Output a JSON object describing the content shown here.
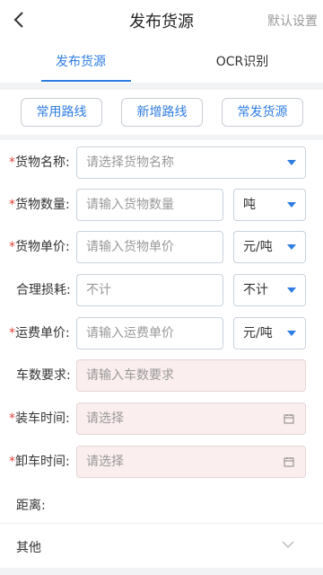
{
  "header": {
    "title": "发布货源",
    "right_action": "默认设置"
  },
  "tabs": [
    {
      "label": "发布货源",
      "active": true
    },
    {
      "label": "OCR识别",
      "active": false
    }
  ],
  "quick_buttons": [
    {
      "label": "常用路线"
    },
    {
      "label": "新增路线"
    },
    {
      "label": "常发货源"
    }
  ],
  "form": {
    "cargo_name": {
      "label": "货物名称:",
      "required": true,
      "placeholder": "请选择货物名称"
    },
    "cargo_quantity": {
      "label": "货物数量:",
      "required": true,
      "placeholder": "请输入货物数量",
      "unit": "吨"
    },
    "cargo_unit_price": {
      "label": "货物单价:",
      "required": true,
      "placeholder": "请输入货物单价",
      "unit": "元/吨"
    },
    "reasonable_loss": {
      "label": "合理损耗:",
      "required": false,
      "placeholder": "不计",
      "option": "不计"
    },
    "freight_unit_price": {
      "label": "运费单价:",
      "required": true,
      "placeholder": "请输入运费单价",
      "unit": "元/吨"
    },
    "vehicle_requirement": {
      "label": "车数要求:",
      "required": false,
      "placeholder": "请输入车数要求"
    },
    "loading_time": {
      "label": "装车时间:",
      "required": true,
      "placeholder": "请选择"
    },
    "unloading_time": {
      "label": "卸车时间:",
      "required": true,
      "placeholder": "请选择"
    },
    "distance": {
      "label": "距离:"
    }
  },
  "other": {
    "label": "其他"
  },
  "required_mark": "*",
  "colors": {
    "accent": "#2f7de1",
    "required": "#e0443c",
    "disabled_bg": "#fbeeee"
  },
  "icons": {
    "back": "chevron-left-icon",
    "dropdown": "caret-down-icon",
    "calendar": "calendar-icon",
    "expand": "chevron-down-icon"
  }
}
